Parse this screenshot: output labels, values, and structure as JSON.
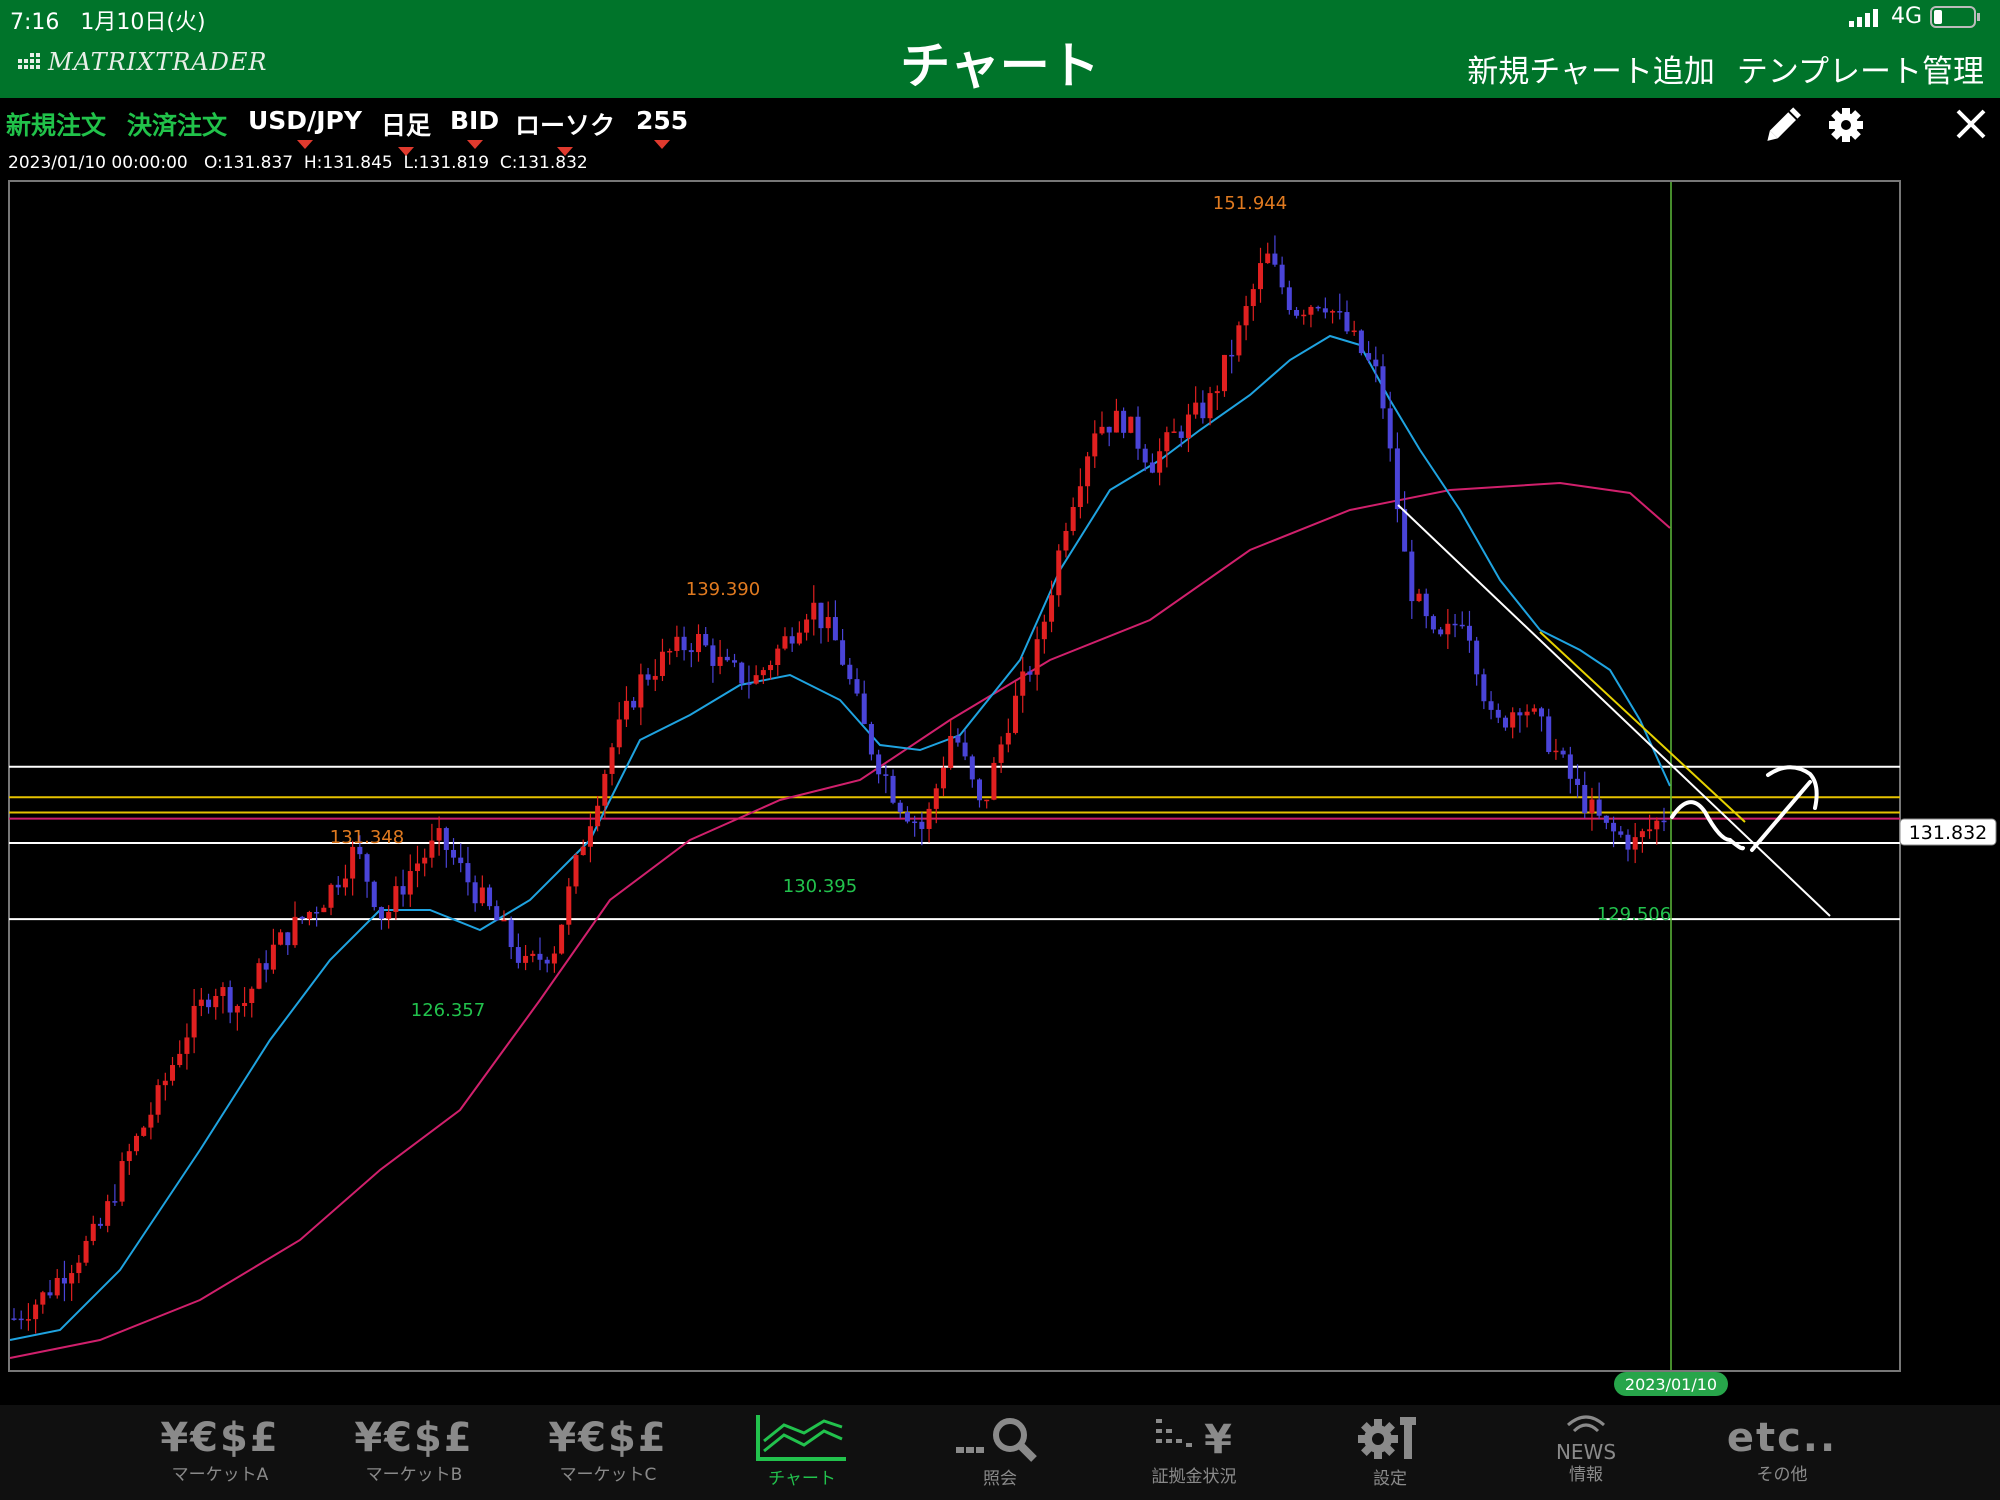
{
  "status": {
    "time": "7:16",
    "date": "1月10日(火)",
    "network": "4G"
  },
  "nav": {
    "logo": "MATRIXTRADER",
    "title": "チャート",
    "add_chart": "新規チャート追加",
    "template": "テンプレート管理"
  },
  "toolbar": {
    "new_order": "新規注文",
    "settle_order": "決済注文",
    "pair": "USD/JPY",
    "timeframe": "日足",
    "price_type": "BID",
    "chart_type": "ローソク",
    "count": "255"
  },
  "ohlc": {
    "datetime": "2023/01/10 00:00:00",
    "open": "O:131.837",
    "high": "H:131.845",
    "low": "L:131.819",
    "close": "C:131.832"
  },
  "chart_data": {
    "type": "candlestick",
    "symbol": "USD/JPY",
    "last_price": "131.832",
    "cursor_date": "2023/01/10",
    "annotations": {
      "high": "151.944",
      "low_right": "129.506",
      "mid_high": "139.390",
      "mid_low": "130.395",
      "left_high": "131.348",
      "left_low": "126.357"
    },
    "ylim": [
      114,
      152
    ],
    "horizontal_levels": [
      {
        "value": 133.4,
        "color": "#ffffff"
      },
      {
        "value": 132.4,
        "color": "#e6c200"
      },
      {
        "value": 131.9,
        "color": "#e6c200"
      },
      {
        "value": 131.7,
        "color": "#d0206c"
      },
      {
        "value": 130.9,
        "color": "#ffffff"
      },
      {
        "value": 128.4,
        "color": "#ffffff"
      }
    ],
    "close_path": [
      115.3,
      116.0,
      117.1,
      118.2,
      120.6,
      122.4,
      124.6,
      126.2,
      125.5,
      127.3,
      128.3,
      129.2,
      130.7,
      128.4,
      130.1,
      131.0,
      129.6,
      128.3,
      126.8,
      127.5,
      131.0,
      134.0,
      136.2,
      137.1,
      137.6,
      136.6,
      136.2,
      137.4,
      138.8,
      137.3,
      134.3,
      132.4,
      131.3,
      134.7,
      131.9,
      135.1,
      137.3,
      141.6,
      144.6,
      144.8,
      143.4,
      144.5,
      145.3,
      147.5,
      150.2,
      148.4,
      148.8,
      147.5,
      146.1,
      139.5,
      137.3,
      138.5,
      134.6,
      135.6,
      134.2,
      132.5,
      131.3,
      130.9,
      131.8
    ]
  },
  "tabs": [
    {
      "icon": "¥€$£",
      "label": "マーケットA"
    },
    {
      "icon": "¥€$£",
      "label": "マーケットB"
    },
    {
      "icon": "¥€$£",
      "label": "マーケットC"
    },
    {
      "icon": "",
      "label": "チャート"
    },
    {
      "icon": "",
      "label": "照会"
    },
    {
      "icon": "¥",
      "label": "証拠金状況"
    },
    {
      "icon": "",
      "label": "設定"
    },
    {
      "icon": "NEWS",
      "label": "情報"
    },
    {
      "icon": "etc..",
      "label": "その他"
    }
  ]
}
